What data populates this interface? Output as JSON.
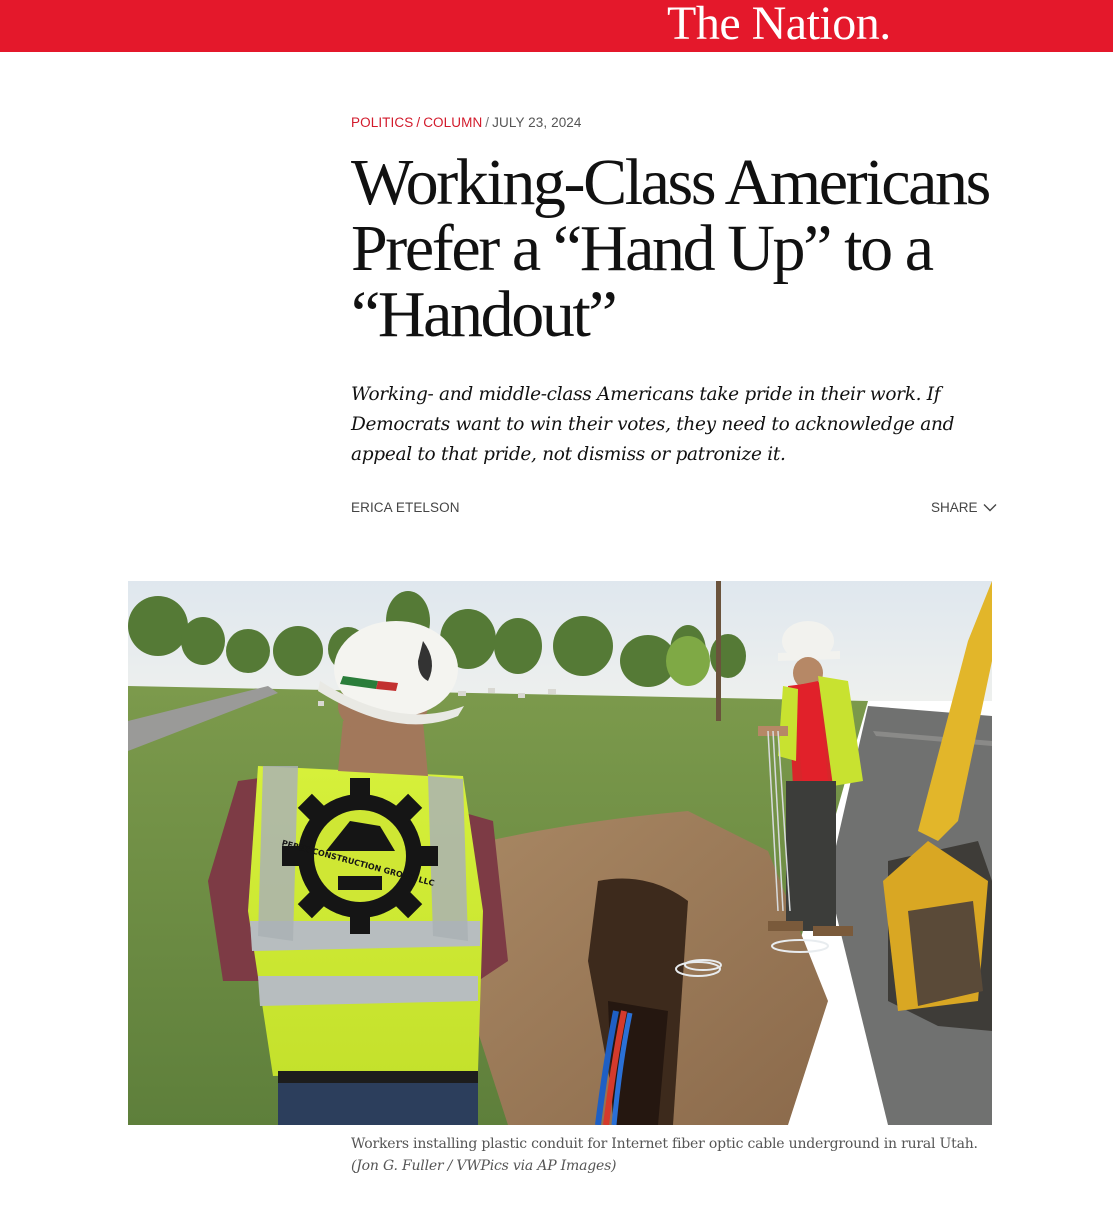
{
  "header": {
    "logo": "The Nation.",
    "brand_color": "#e4182b"
  },
  "article": {
    "category_primary": "Politics",
    "category_secondary": "Column",
    "date": "July 23, 2024",
    "headline": "Working-Class Americans Prefer a “Hand Up” to a “Handout”",
    "dek": "Working- and middle-class Americans take pride in their work. If Democrats want to win their votes, they need to acknowledge and appeal to that pride, not dismiss or patronize it.",
    "author": "Erica Etelson",
    "share_label": "Share",
    "share_icon": "chevron-down-icon"
  },
  "photo": {
    "caption": "Workers installing plastic conduit for Internet fiber optic cable underground in rural Utah.",
    "credit": "(Jon G. Fuller / VWPics via AP Images)",
    "vest_text": "PEREZ CONSTRUCTION GROUP, LLC"
  }
}
